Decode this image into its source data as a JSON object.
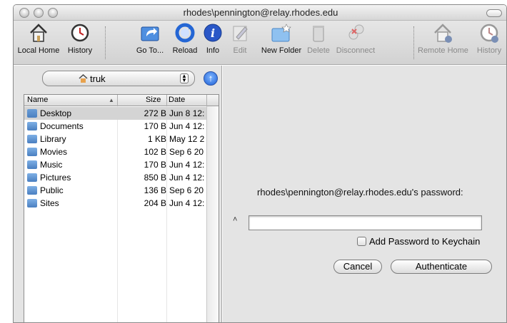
{
  "window": {
    "title": "rhodes\\pennington@relay.rhodes.edu"
  },
  "toolbar": {
    "items": [
      {
        "label": "Local Home",
        "icon": "house-icon",
        "enabled": true
      },
      {
        "label": "History",
        "icon": "clock-icon",
        "enabled": true
      },
      {
        "label": "Go To...",
        "icon": "folder-goto-icon",
        "enabled": true
      },
      {
        "label": "Reload",
        "icon": "reload-icon",
        "enabled": true
      },
      {
        "label": "Info",
        "icon": "info-icon",
        "enabled": true
      },
      {
        "label": "Edit",
        "icon": "edit-icon",
        "enabled": false
      },
      {
        "label": "New Folder",
        "icon": "new-folder-icon",
        "enabled": true
      },
      {
        "label": "Delete",
        "icon": "trash-icon",
        "enabled": false
      },
      {
        "label": "Disconnect",
        "icon": "disconnect-icon",
        "enabled": false
      },
      {
        "label": "Remote Home",
        "icon": "remote-house-icon",
        "enabled": false
      },
      {
        "label": "History",
        "icon": "remote-clock-icon",
        "enabled": false
      }
    ]
  },
  "browser": {
    "location": "truk",
    "columns": {
      "name": "Name",
      "size": "Size",
      "date": "Date"
    },
    "files": [
      {
        "name": "Desktop",
        "size": "272 B",
        "date": "Jun 8 12:",
        "selected": true
      },
      {
        "name": "Documents",
        "size": "170 B",
        "date": "Jun 4 12:",
        "selected": false
      },
      {
        "name": "Library",
        "size": "1 KB",
        "date": "May 12 2",
        "selected": false
      },
      {
        "name": "Movies",
        "size": "102 B",
        "date": "Sep 6 20",
        "selected": false
      },
      {
        "name": "Music",
        "size": "170 B",
        "date": "Jun 4 12:",
        "selected": false
      },
      {
        "name": "Pictures",
        "size": "850 B",
        "date": "Jun 4 12:",
        "selected": false
      },
      {
        "name": "Public",
        "size": "136 B",
        "date": "Sep 6 20",
        "selected": false
      },
      {
        "name": "Sites",
        "size": "204 B",
        "date": "Jun 4 12:",
        "selected": false
      }
    ]
  },
  "auth": {
    "prompt": "rhodes\\pennington@relay.rhodes.edu's password:",
    "password_value": "",
    "keychain_label": "Add Password to Keychain",
    "cancel_label": "Cancel",
    "authenticate_label": "Authenticate"
  },
  "colors": {
    "accent": "#1d5fd6",
    "selection": "#d4d4d4",
    "folder": "#7fb0e6"
  }
}
